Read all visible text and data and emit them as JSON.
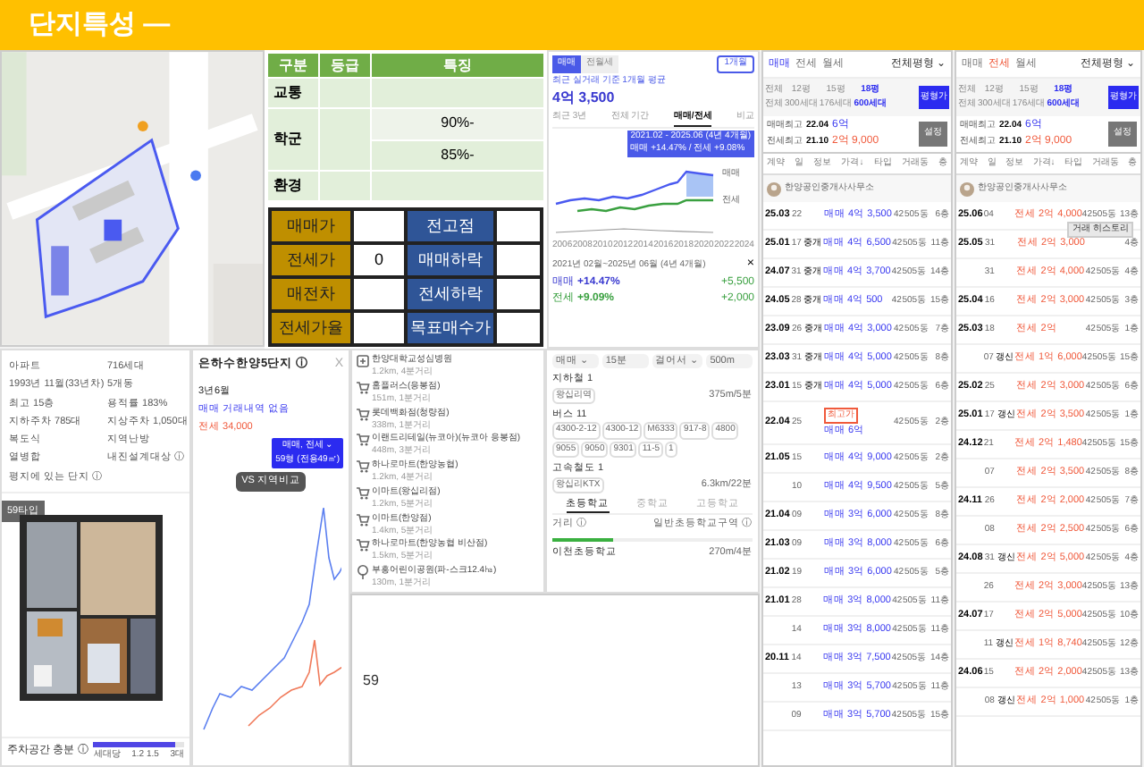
{
  "header": {
    "title": "단지특성 —"
  },
  "map": {
    "kind": "picture"
  },
  "grade_table": {
    "columns": [
      "구분",
      "등급",
      "특징"
    ],
    "rows": [
      {
        "label": "교통"
      },
      {
        "label": "학군",
        "features": [
          "90%-",
          "85%-"
        ]
      },
      {
        "label": "환경"
      }
    ]
  },
  "price_table": [
    {
      "label": "매매가",
      "label2": "전고점"
    },
    {
      "label": "전세가",
      "value": "0",
      "label2": "매매하락"
    },
    {
      "label": "매전차",
      "label2": "전세하락"
    },
    {
      "label": "전세가율",
      "label2": "목표매수가"
    }
  ],
  "trend_panel": {
    "tabs": [
      {
        "label": "매매",
        "selected": true
      },
      {
        "label": "전월세",
        "selected": false
      }
    ],
    "period": "1개월",
    "subtitle": "최근 실거래 기준 1개월 평균",
    "price": "4억 3,500",
    "views": [
      {
        "label": "최근 3년",
        "selected": false
      },
      {
        "label": "전체 기간",
        "selected": false
      },
      {
        "label": "매매/전세",
        "selected": true
      },
      {
        "label": "비교",
        "selected": false
      }
    ],
    "tooltip": [
      "2021.02 - 2025.06 (4년 4개월)",
      "매매 +14.47%  /  전세 +9.08%"
    ],
    "legend": [
      "매매",
      "전세"
    ],
    "years": [
      "2006",
      "2008",
      "2010",
      "2012",
      "2014",
      "2016",
      "2018",
      "2020",
      "2022",
      "2024"
    ],
    "range": "2021년 02월~2025년 06월 (4년 4개월)",
    "close": "×",
    "changes": [
      {
        "kind": "sale",
        "label": "매매",
        "pct": "+14.47%",
        "amount": "+5,500"
      },
      {
        "kind": "jeonse",
        "label": "전세",
        "pct": "+9.09%",
        "amount": "+2,000"
      }
    ]
  },
  "complex_info": {
    "facts": [
      "아파트",
      "716세대",
      "1993년 11월(33년차)",
      "5개동",
      "최고 15층",
      "용적률 183%",
      "지하주차 785대",
      "지상주차 1,050대",
      "복도식",
      "지역난방",
      "열병합",
      "내진설계대상 ⓘ",
      "평지에 있는 단지 ⓘ"
    ],
    "plan_tag": "59타입",
    "floorplan": {
      "kind": "picture"
    },
    "parking_label": "주차공간 충분 ⓘ",
    "parking": {
      "level": 0.9
    },
    "parking_scale": [
      "세대당",
      "1.2 1.5",
      "3대"
    ]
  },
  "price_chart": {
    "title": "은하수한양5단지 ⓘ",
    "close": "X",
    "period": "3년6월",
    "sale": "매매 거래내역 없음",
    "jeonse": "전세 34,000",
    "filter": [
      "매매, 전세 ⌄",
      "59형 (전용49㎡)"
    ],
    "compare": "VS 지역비교"
  },
  "amenities": [
    {
      "kind": "hospital",
      "name": "한양대학교성심병원",
      "distance": "1.2km, 4분거리"
    },
    {
      "kind": "mart",
      "name": "홈플러스(응봉점)",
      "distance": "151m, 1분거리"
    },
    {
      "kind": "mart",
      "name": "롯데백화점(청량점)",
      "distance": "338m, 1분거리"
    },
    {
      "kind": "mart",
      "name": "이랜드리테일(뉴코아)(뉴코아 응봉점)",
      "distance": "448m, 3분거리"
    },
    {
      "kind": "mart",
      "name": "하나로마트(한양농협)",
      "distance": "1.2km, 4분거리"
    },
    {
      "kind": "mart",
      "name": "이마트(왕십리점)",
      "distance": "1.2km, 5분거리"
    },
    {
      "kind": "mart",
      "name": "이마트(한양점)",
      "distance": "1.4km, 5분거리"
    },
    {
      "kind": "mart",
      "name": "하나로마트(한양농협 비산점)",
      "distance": "1.5km, 5분거리"
    },
    {
      "kind": "park",
      "name": "부흥어린이공원(파-스크12.4㏊)",
      "distance": "130m, 1분거리"
    }
  ],
  "transit": {
    "filters": [
      "매매 ⌄",
      "15분",
      "걸어서 ⌄",
      "500m"
    ],
    "sections": [
      {
        "title": "지하철 1",
        "pills": [
          "왕십리역"
        ],
        "note": "375m/5분"
      },
      {
        "title": "버스 11",
        "pills": [
          "4300-2-12",
          "4300-12",
          "M6333",
          "917-8",
          "4800",
          "9055",
          "9050",
          "9301",
          "11-5",
          "1"
        ]
      },
      {
        "title": "고속철도 1",
        "pills": [
          "왕십리KTX"
        ],
        "note": "6.3km/22분"
      }
    ],
    "school_tabs": [
      {
        "label": "초등학교",
        "selected": true
      },
      {
        "label": "중학교",
        "selected": false
      },
      {
        "label": "고등학교",
        "selected": false
      }
    ],
    "school_row": [
      "거리 ⓘ",
      "일반초등학교구역 ⓘ"
    ],
    "walk": {
      "level": 0.3
    },
    "school": "이천초등학교",
    "school_distance": "270m/4분"
  },
  "note_box": {
    "value": "59"
  },
  "lists": [
    {
      "kind": "sale",
      "tabs": [
        {
          "label": "매매",
          "selected": true
        },
        {
          "label": "전세",
          "selected": false
        },
        {
          "label": "월세",
          "selected": false
        }
      ],
      "size_filter": "전체평형 ⌄",
      "sizes": [
        {
          "size": "전체",
          "units": "전체",
          "selected": false
        },
        {
          "size": "12평",
          "units": "300세대",
          "selected": false
        },
        {
          "size": "15평",
          "units": "176세대",
          "selected": false
        },
        {
          "size": "18평",
          "units": "600세대",
          "selected": true
        }
      ],
      "size_button": "평형가",
      "stats": [
        {
          "label": "매매최고",
          "date": "22.04",
          "price": "6억",
          "kind": "sale"
        },
        {
          "label": "전세최고",
          "date": "21.10",
          "price": "2억 9,000",
          "kind": "jeonse"
        }
      ],
      "stats_button": "설정",
      "columns": [
        "계약",
        "일",
        "정보",
        "가격↓",
        "타입",
        "거래동",
        "층"
      ],
      "agent": "한양공인중개사사무소",
      "rows": [
        {
          "ym": "25.03",
          "day": "22",
          "price": "매매 4억 3,500",
          "type": "42",
          "dong": "505동",
          "floor": "6층"
        },
        {
          "ym": "25.01",
          "day": "17",
          "info": "중개",
          "price": "매매 4억 6,500",
          "type": "42",
          "dong": "505동",
          "floor": "11층"
        },
        {
          "ym": "24.07",
          "day": "31",
          "info": "중개",
          "price": "매매 4억 3,700",
          "type": "42",
          "dong": "505동",
          "floor": "14층"
        },
        {
          "ym": "24.05",
          "day": "28",
          "info": "중개",
          "price": "매매 4억 500",
          "type": "42",
          "dong": "505동",
          "floor": "15층"
        },
        {
          "ym": "23.09",
          "day": "26",
          "info": "중개",
          "price": "매매 4억 3,000",
          "type": "42",
          "dong": "505동",
          "floor": "7층"
        },
        {
          "ym": "23.03",
          "day": "31",
          "info": "중개",
          "price": "매매 4억 5,000",
          "type": "42",
          "dong": "505동",
          "floor": "8층"
        },
        {
          "ym": "23.01",
          "day": "15",
          "info": "중개",
          "price": "매매 4억 5,000",
          "type": "42",
          "dong": "505동",
          "floor": "6층"
        },
        {
          "ym": "22.04",
          "day": "25",
          "tag": "최고가",
          "price": "매매 6억",
          "type": "42",
          "dong": "505동",
          "floor": "2층"
        },
        {
          "ym": "21.05",
          "day": "15",
          "price": "매매 4억 9,000",
          "type": "42",
          "dong": "505동",
          "floor": "2층"
        },
        {
          "day": "10",
          "price": "매매 4억 9,500",
          "type": "42",
          "dong": "505동",
          "floor": "5층"
        },
        {
          "ym": "21.04",
          "day": "09",
          "price": "매매 3억 6,000",
          "type": "42",
          "dong": "505동",
          "floor": "8층"
        },
        {
          "ym": "21.03",
          "day": "09",
          "price": "매매 3억 8,000",
          "type": "42",
          "dong": "505동",
          "floor": "6층"
        },
        {
          "ym": "21.02",
          "day": "19",
          "price": "매매 3억 6,000",
          "type": "42",
          "dong": "505동",
          "floor": "5층"
        },
        {
          "ym": "21.01",
          "day": "28",
          "price": "매매 3억 8,000",
          "type": "42",
          "dong": "505동",
          "floor": "11층"
        },
        {
          "day": "14",
          "price": "매매 3억 8,000",
          "type": "42",
          "dong": "505동",
          "floor": "11층"
        },
        {
          "ym": "20.11",
          "day": "14",
          "price": "매매 3억 7,500",
          "type": "42",
          "dong": "505동",
          "floor": "14층"
        },
        {
          "day": "13",
          "price": "매매 3억 5,700",
          "type": "42",
          "dong": "505동",
          "floor": "11층"
        },
        {
          "day": "09",
          "price": "매매 3억 5,700",
          "type": "42",
          "dong": "505동",
          "floor": "15층"
        }
      ]
    },
    {
      "kind": "jeonse",
      "tabs": [
        {
          "label": "매매",
          "selected": false
        },
        {
          "label": "전세",
          "selected": true
        },
        {
          "label": "월세",
          "selected": false
        }
      ],
      "size_filter": "전체평형 ⌄",
      "sizes": [
        {
          "size": "전체",
          "units": "전체",
          "selected": false
        },
        {
          "size": "12평",
          "units": "300세대",
          "selected": false
        },
        {
          "size": "15평",
          "units": "176세대",
          "selected": false
        },
        {
          "size": "18평",
          "units": "600세대",
          "selected": true
        }
      ],
      "size_button": "평형가",
      "stats": [
        {
          "label": "매매최고",
          "date": "22.04",
          "price": "6억",
          "kind": "sale"
        },
        {
          "label": "전세최고",
          "date": "21.10",
          "price": "2억 9,000",
          "kind": "jeonse"
        }
      ],
      "stats_button": "설정",
      "columns": [
        "계약",
        "일",
        "정보",
        "가격↓",
        "타입",
        "거래동",
        "층"
      ],
      "agent": "한양공인중개사사무소",
      "rows": [
        {
          "ym": "25.06",
          "day": "04",
          "price": "전세 2억 4,000",
          "type": "42",
          "dong": "505동",
          "floor": "13층"
        },
        {
          "ym": "25.05",
          "day": "31",
          "price": "전세 2억 3,000",
          "tooltip": "거래 히스토리",
          "floor": "4층"
        },
        {
          "day": "31",
          "price": "전세 2억 4,000",
          "type": "42",
          "dong": "505동",
          "floor": "4층"
        },
        {
          "ym": "25.04",
          "day": "16",
          "price": "전세 2억 3,000",
          "type": "42",
          "dong": "505동",
          "floor": "3층"
        },
        {
          "ym": "25.03",
          "day": "18",
          "price": "전세 2억",
          "type": "42",
          "dong": "505동",
          "floor": "1층"
        },
        {
          "day": "07",
          "info": "갱신",
          "price": "전세 1억 6,000",
          "type": "42",
          "dong": "505동",
          "floor": "15층"
        },
        {
          "ym": "25.02",
          "day": "25",
          "price": "전세 2억 3,000",
          "type": "42",
          "dong": "505동",
          "floor": "6층"
        },
        {
          "ym": "25.01",
          "day": "17",
          "info": "갱신",
          "price": "전세 2억 3,500",
          "type": "42",
          "dong": "505동",
          "floor": "1층"
        },
        {
          "ym": "24.12",
          "day": "21",
          "price": "전세 2억 1,480",
          "type": "42",
          "dong": "505동",
          "floor": "15층"
        },
        {
          "day": "07",
          "price": "전세 2억 3,500",
          "type": "42",
          "dong": "505동",
          "floor": "8층"
        },
        {
          "ym": "24.11",
          "day": "26",
          "price": "전세 2억 2,000",
          "type": "42",
          "dong": "505동",
          "floor": "7층"
        },
        {
          "day": "08",
          "price": "전세 2억 2,500",
          "type": "42",
          "dong": "505동",
          "floor": "6층"
        },
        {
          "ym": "24.08",
          "day": "31",
          "info": "갱신",
          "price": "전세 2억 5,000",
          "type": "42",
          "dong": "505동",
          "floor": "4층"
        },
        {
          "day": "26",
          "price": "전세 2억 3,000",
          "type": "42",
          "dong": "505동",
          "floor": "13층"
        },
        {
          "ym": "24.07",
          "day": "17",
          "price": "전세 2억 5,000",
          "type": "42",
          "dong": "505동",
          "floor": "10층"
        },
        {
          "day": "11",
          "info": "갱신",
          "price": "전세 1억 8,740",
          "type": "42",
          "dong": "505동",
          "floor": "12층"
        },
        {
          "ym": "24.06",
          "day": "15",
          "price": "전세 2억 2,000",
          "type": "42",
          "dong": "505동",
          "floor": "13층"
        },
        {
          "day": "08",
          "info": "갱신",
          "price": "전세 2억 1,000",
          "type": "42",
          "dong": "505동",
          "floor": "1층"
        }
      ]
    }
  ]
}
